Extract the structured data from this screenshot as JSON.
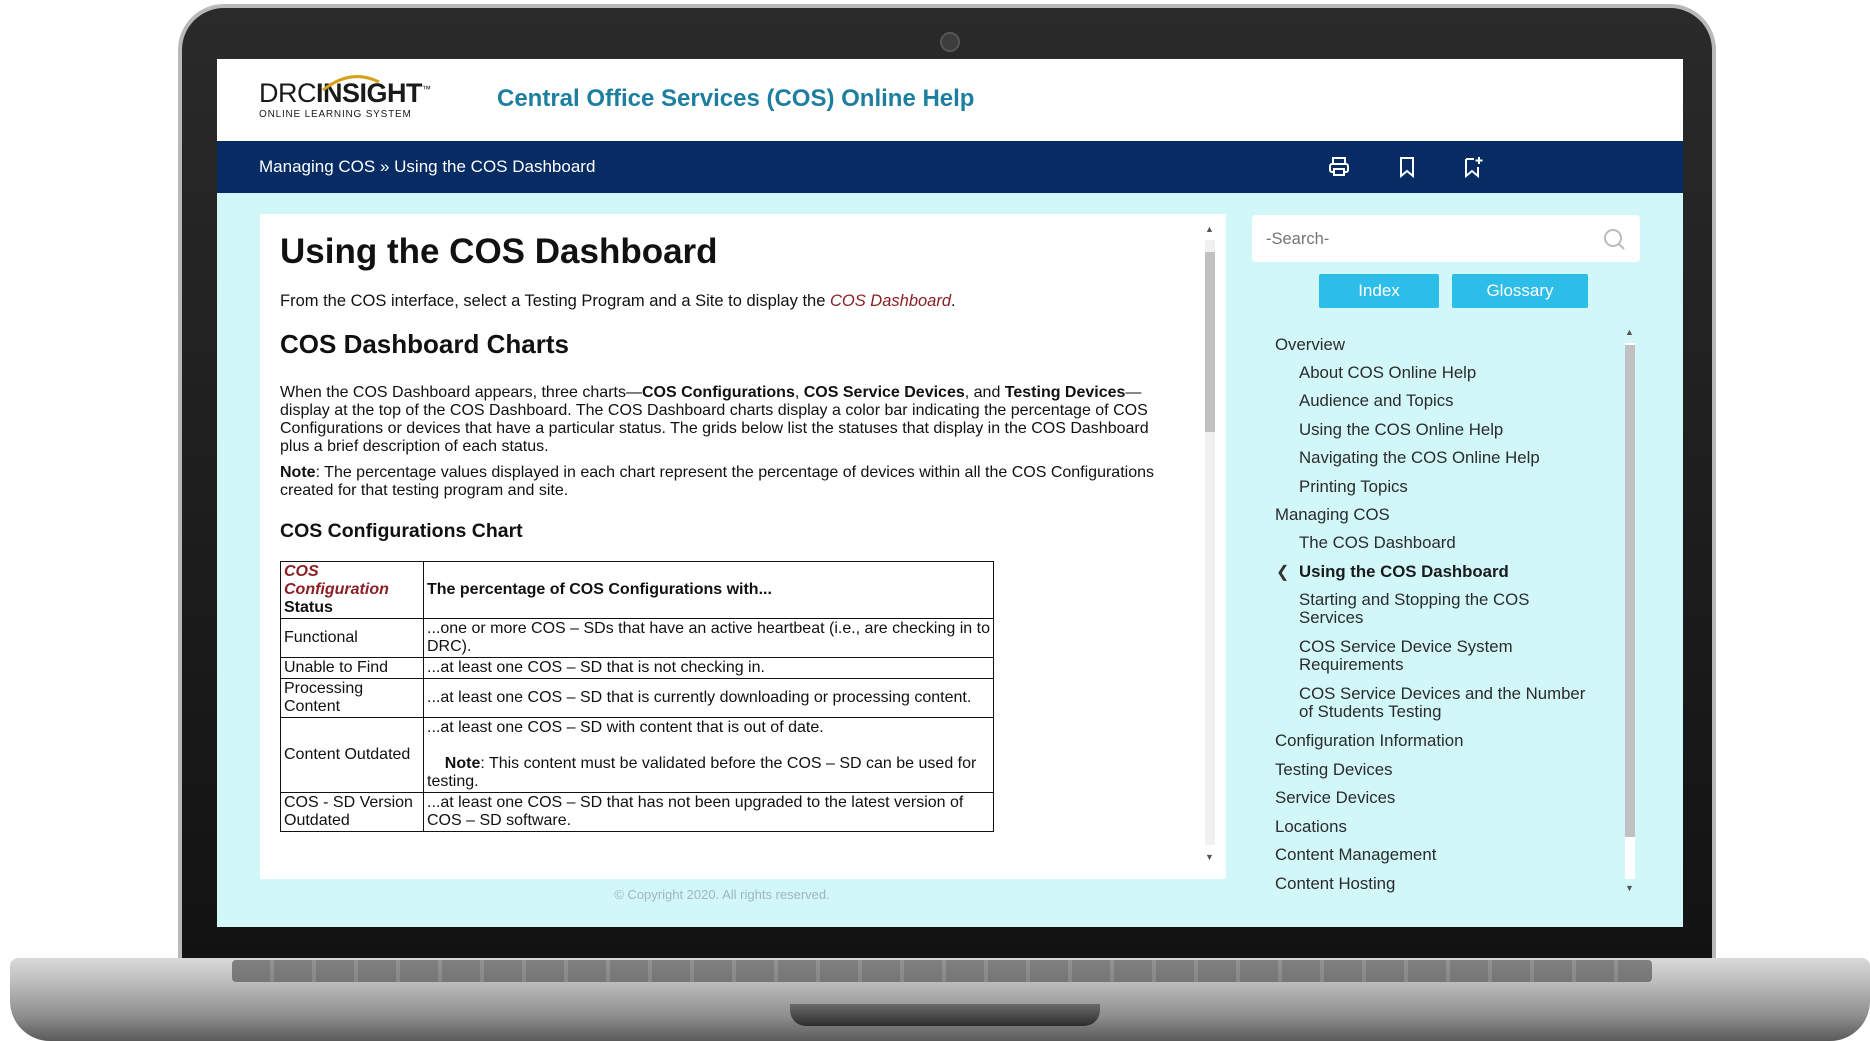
{
  "header": {
    "logo_main_1": "DRC",
    "logo_main_2": "INSIGHT",
    "logo_tm": "™",
    "logo_sub": "ONLINE LEARNING SYSTEM",
    "title": "Central Office Services (COS) Online Help"
  },
  "navbar": {
    "breadcrumb_1": "Managing COS",
    "breadcrumb_sep": " » ",
    "breadcrumb_2": "Using the COS Dashboard",
    "icons": [
      "print-icon",
      "bookmark-icon",
      "add-bookmark-icon"
    ]
  },
  "content": {
    "title": "Using the COS Dashboard",
    "intro_pre": "From the COS interface, select a Testing Program and a Site to display the ",
    "intro_link": "COS Dashboard",
    "intro_post": ".",
    "section_title": "COS Dashboard Charts",
    "para_1": "When the COS Dashboard appears, three charts—",
    "para_b1": "COS Configurations",
    "para_2": ", ",
    "para_b2": "COS Service Devices",
    "para_3": ", and ",
    "para_b3": "Testing Devices",
    "para_4": "—display at the top of the COS Dashboard. The COS Dashboard charts display a color bar indicating the percentage of COS Configurations or devices that have a particular status. The grids below list the statuses that display in the COS Dashboard plus a brief description of each status.",
    "note_label": "Note",
    "note_text": ": The percentage values displayed in each chart represent the percentage of devices within all the COS Configurations created for that testing program and site.",
    "subsection_title": "COS Configurations Chart",
    "table": {
      "header_col1_red": "COS Configuration",
      "header_col1_rest": "Status",
      "header_col2": "The percentage of COS Configurations with...",
      "rows": [
        {
          "status": "Functional",
          "desc": "...one or more COS – SDs that have an active heartbeat (i.e., are checking in to DRC)."
        },
        {
          "status": "Unable to Find",
          "desc": "...at least one COS – SD that is not checking in."
        },
        {
          "status": "Processing Content",
          "desc": "...at least one COS – SD that is currently downloading or processing content."
        },
        {
          "status": "Content Outdated",
          "desc": "...at least one COS – SD with content that is out of date.",
          "note_label": "Note",
          "note": ": This content must be validated before the COS – SD can be used for testing."
        },
        {
          "status": "COS - SD Version Outdated",
          "desc": "...at least one COS – SD that has not been upgraded to the latest version of COS – SD software."
        }
      ]
    }
  },
  "sidebar": {
    "search_placeholder": "-Search-",
    "index_label": "Index",
    "glossary_label": "Glossary",
    "toc": {
      "overview": "Overview",
      "about": "About COS Online Help",
      "audience": "Audience and Topics",
      "using_help": "Using the COS Online Help",
      "navigating": "Navigating the COS Online Help",
      "printing": "Printing Topics",
      "managing": "Managing COS",
      "dashboard": "The COS Dashboard",
      "using_dashboard": "Using the COS Dashboard",
      "starting": "Starting and Stopping the COS Services",
      "requirements": "COS Service Device System Requirements",
      "devices_students": "COS Service Devices and the Number of Students Testing",
      "config_info": "Configuration Information",
      "testing_devices": "Testing Devices",
      "service_devices": "Service Devices",
      "locations": "Locations",
      "content_mgmt": "Content Management",
      "content_hosting": "Content Hosting"
    }
  },
  "footer": {
    "copyright": "© Copyright 2020. All rights reserved."
  },
  "colors": {
    "navbar": "#072b63",
    "title": "#1d7fa0",
    "background": "#d1f7f9",
    "button": "#2cbde9",
    "link": "#8a1f24"
  }
}
